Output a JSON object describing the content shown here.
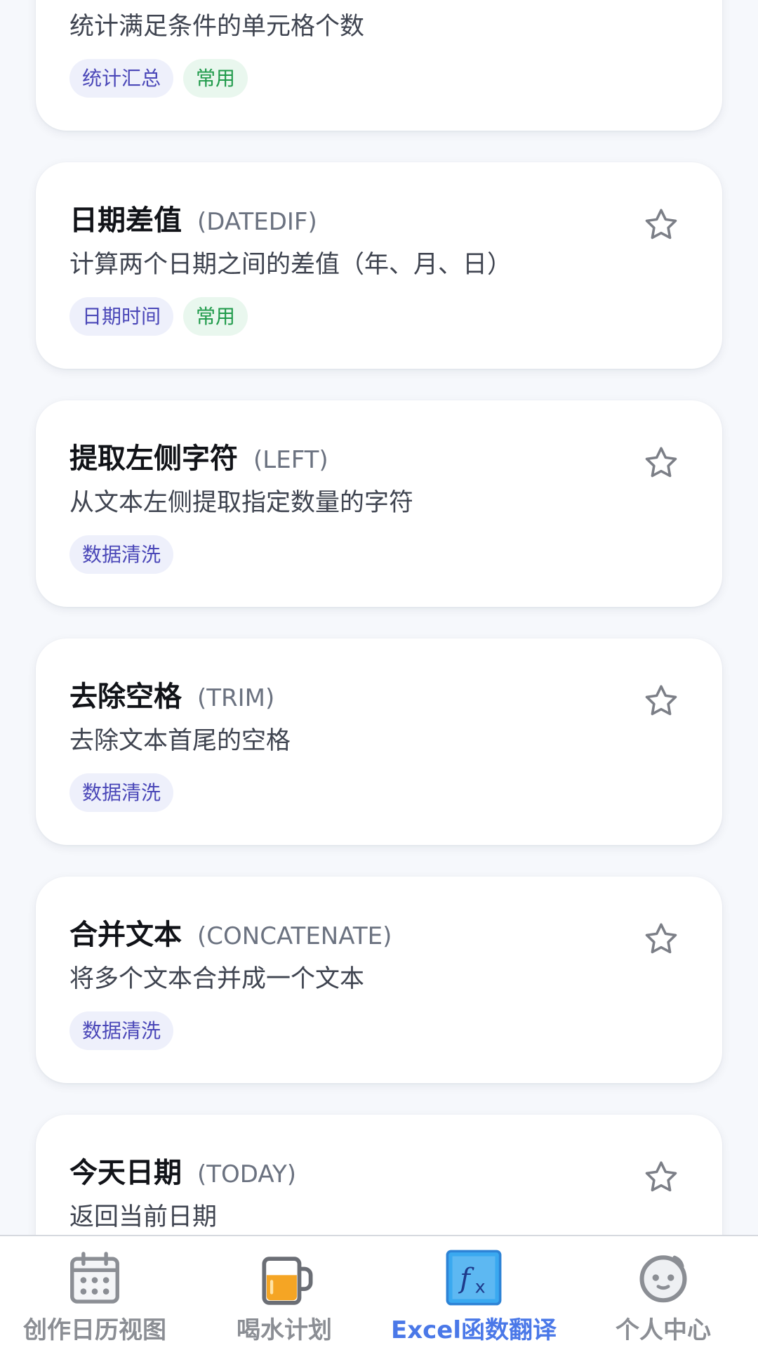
{
  "cards": [
    {
      "title": "",
      "code": "",
      "desc": "统计满足条件的单元格个数",
      "tags": [
        "统计汇总",
        "常用"
      ]
    },
    {
      "title": "日期差值",
      "code": "(DATEDIF)",
      "desc": "计算两个日期之间的差值（年、月、日）",
      "tags": [
        "日期时间",
        "常用"
      ]
    },
    {
      "title": "提取左侧字符",
      "code": "(LEFT)",
      "desc": "从文本左侧提取指定数量的字符",
      "tags": [
        "数据清洗"
      ]
    },
    {
      "title": "去除空格",
      "code": "(TRIM)",
      "desc": "去除文本首尾的空格",
      "tags": [
        "数据清洗"
      ]
    },
    {
      "title": "合并文本",
      "code": "(CONCATENATE)",
      "desc": "将多个文本合并成一个文本",
      "tags": [
        "数据清洗"
      ]
    },
    {
      "title": "今天日期",
      "code": "(TODAY)",
      "desc": "返回当前日期",
      "tags": []
    }
  ],
  "tabbar": {
    "tabs": [
      {
        "label": "创作日历视图",
        "icon": "calendar-icon"
      },
      {
        "label": "喝水计划",
        "icon": "beer-mug-icon"
      },
      {
        "label": "Excel函数翻译",
        "icon": "fx-function-icon"
      },
      {
        "label": "个人中心",
        "icon": "smiley-face-icon"
      }
    ],
    "active_index": 2
  },
  "colors": {
    "accent": "#4a78e8",
    "tag_category_bg": "#eef0fb",
    "tag_category_text": "#4a47b8",
    "tag_common_bg": "#e9f7ee",
    "tag_common_text": "#1f9a4a",
    "inactive_tab": "#8b8e94"
  }
}
